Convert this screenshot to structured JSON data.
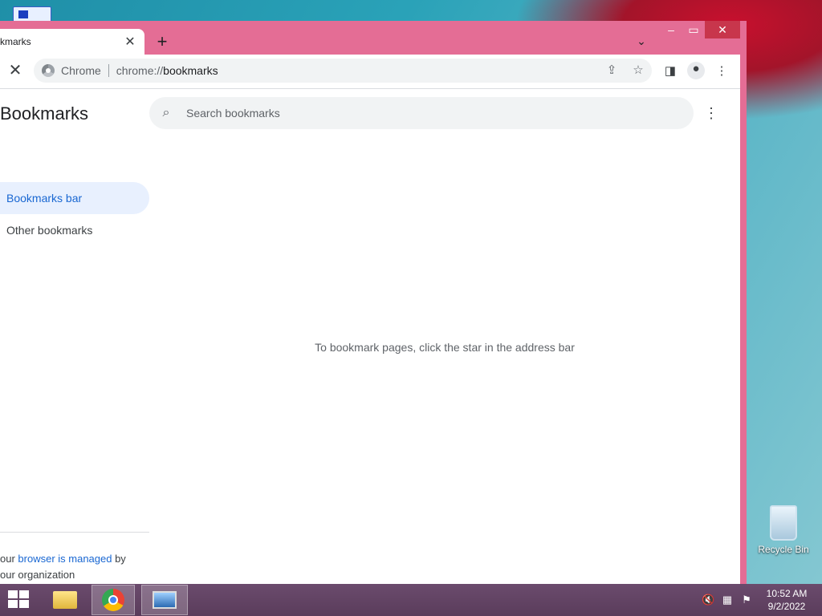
{
  "desktop": {
    "recycle_bin_label": "Recycle Bin"
  },
  "browser": {
    "tab": {
      "title": "kmarks"
    },
    "omnibox": {
      "site_chip": "Chrome",
      "url_scheme": "chrome://",
      "url_path": "bookmarks"
    }
  },
  "bookmarks_page": {
    "title": "Bookmarks",
    "search_placeholder": "Search bookmarks",
    "nav": [
      {
        "label": "Bookmarks bar",
        "selected": true
      },
      {
        "label": "Other bookmarks",
        "selected": false
      }
    ],
    "empty_message": "To bookmark pages, click the star in the address bar",
    "managed_notice": {
      "prefix": "our ",
      "link": "browser is managed",
      "suffix": " by",
      "line2": "our organization"
    }
  },
  "taskbar": {
    "time": "10:52 AM",
    "date": "9/2/2022"
  },
  "icons": [
    "start-icon",
    "file-explorer-icon",
    "chrome-icon",
    "photos-icon",
    "volume-muted-icon",
    "network-icon",
    "action-center-icon"
  ]
}
